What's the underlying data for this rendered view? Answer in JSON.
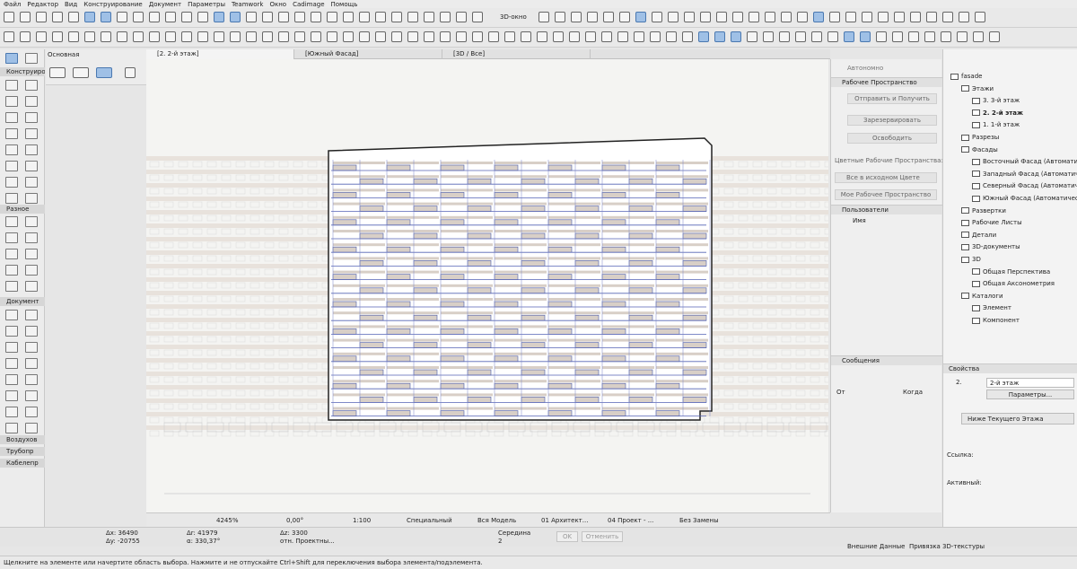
{
  "menu": [
    "Файл",
    "Редактор",
    "Вид",
    "Конструирование",
    "Документ",
    "Параметры",
    "Teamwork",
    "Окно",
    "Cadimage",
    "Помощь"
  ],
  "toolbar": {
    "window3d_label": "3D-окно"
  },
  "toolbox": {
    "section_design": "Конструиро",
    "section_misc": "Разное",
    "section_document": "Документ",
    "section_air": "Воздухов",
    "section_pipe": "Трубопр",
    "section_cable": "Кабелепр"
  },
  "infobox": {
    "label": "Основная"
  },
  "tabs": [
    "[2. 2-й этаж]",
    "[Южный Фасад]",
    "[3D / Все]"
  ],
  "teamwork": {
    "mode": "Автономно",
    "workspace_title": "Рабочее Пространство",
    "send_receive": "Отправить и Получить",
    "reserve": "Зарезервировать",
    "release": "Освободить",
    "colored_label": "Цветные Рабочие Пространства:",
    "colored_value": "Все в исходном Цвете",
    "my_workspace": "Мое Рабочее Пространство",
    "users_title": "Пользователи",
    "users_name_col": "Имя",
    "messages_title": "Сообщения",
    "from_col": "От",
    "when_col": "Когда"
  },
  "navigator": {
    "items": [
      {
        "label": "fasade",
        "level": 0,
        "bold": false
      },
      {
        "label": "Этажи",
        "level": 1,
        "bold": false
      },
      {
        "label": "3. 3-й этаж",
        "level": 2,
        "bold": false
      },
      {
        "label": "2. 2-й этаж",
        "level": 2,
        "bold": true
      },
      {
        "label": "1. 1-й этаж",
        "level": 2,
        "bold": false
      },
      {
        "label": "Разрезы",
        "level": 1,
        "bold": false
      },
      {
        "label": "Фасады",
        "level": 1,
        "bold": false
      },
      {
        "label": "Восточный Фасад (Автоматичес",
        "level": 2,
        "bold": false
      },
      {
        "label": "Западный Фасад (Автоматичес",
        "level": 2,
        "bold": false
      },
      {
        "label": "Северный Фасад (Автоматичес",
        "level": 2,
        "bold": false
      },
      {
        "label": "Южный Фасад (Автоматичес",
        "level": 2,
        "bold": false
      },
      {
        "label": "Развертки",
        "level": 1,
        "bold": false
      },
      {
        "label": "Рабочие Листы",
        "level": 1,
        "bold": false
      },
      {
        "label": "Детали",
        "level": 1,
        "bold": false
      },
      {
        "label": "3D-документы",
        "level": 1,
        "bold": false
      },
      {
        "label": "3D",
        "level": 1,
        "bold": false
      },
      {
        "label": "Общая Перспектива",
        "level": 2,
        "bold": false
      },
      {
        "label": "Общая Аксонометрия",
        "level": 2,
        "bold": false
      },
      {
        "label": "Каталоги",
        "level": 1,
        "bold": false
      },
      {
        "label": "Элемент",
        "level": 2,
        "bold": false
      },
      {
        "label": "Компонент",
        "level": 2,
        "bold": false
      }
    ]
  },
  "properties": {
    "title": "Свойства",
    "index": "2.",
    "story": "2-й этаж",
    "params_button": "Параметры...",
    "view_mode": "Ниже Текущего Этажа",
    "link_label": "Ссылка:",
    "active_label": "Активный:"
  },
  "statusbar": {
    "zoom": "4245%",
    "angle": "0,00°",
    "scale": "1:100",
    "layer": "Специальный",
    "model": "Вся Модель",
    "layer_combo": "01 Архитект...",
    "pen_set": "04 Проект - ...",
    "override": "Без Замены"
  },
  "coords": {
    "dx": "Δx: 36490",
    "dy": "Δy: -20755",
    "da": "Δr: 41979",
    "aangle": "α: 330,37°",
    "dz": "Δz: 3300",
    "ref": "отн. Проектны...",
    "snap": "Середина",
    "snap_val": "2",
    "ok": "OK",
    "cancel": "Отменить",
    "external": "Внешние Данные",
    "texture": "Привязка 3D-текстуры"
  },
  "hint": "Щелкните на элементе или начертите область выбора. Нажмите и не отпускайте Ctrl+Shift для переключения выбора элемента/подэлемента."
}
